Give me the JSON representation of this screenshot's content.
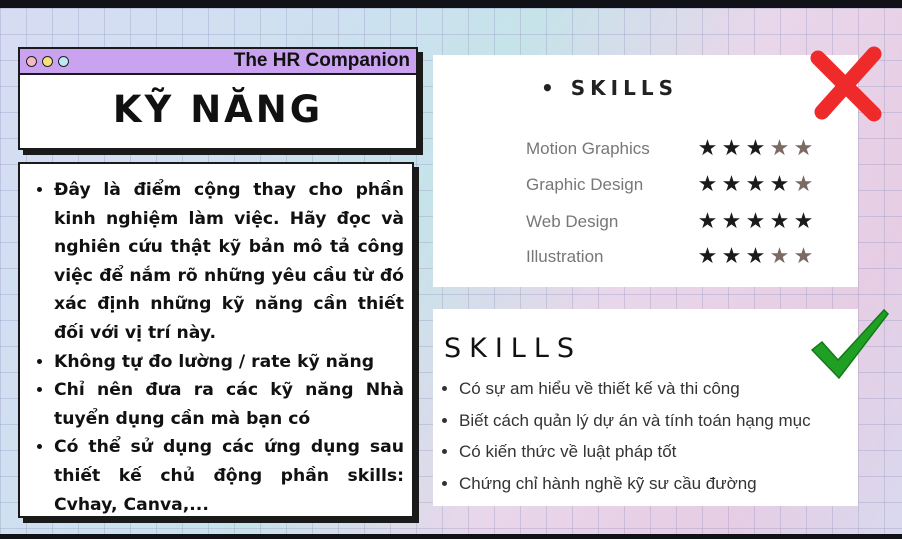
{
  "title_card": {
    "brand": "The HR Companion",
    "title": "KỸ NĂNG"
  },
  "tips": [
    "Đây là điểm cộng thay cho phần kinh nghiệm làm việc. Hãy đọc và nghiên cứu thật kỹ bản mô tả công việc để nắm rõ những yêu cầu từ đó xác định những kỹ năng cần thiết đối với vị trí này.",
    "Không tự đo lường / rate kỹ năng",
    "Chỉ nên đưa ra các kỹ năng Nhà tuyển dụng cần mà bạn có",
    "Có thể sử dụng các ứng dụng sau thiết kế chủ động phần skills: Cvhay, Canva,..."
  ],
  "bad_example": {
    "heading": "• SKILLS",
    "skills": [
      {
        "name": "Motion Graphics",
        "rating": 3,
        "max": 5
      },
      {
        "name": "Graphic Design",
        "rating": 4,
        "max": 5
      },
      {
        "name": "Web Design",
        "rating": 5,
        "max": 5
      },
      {
        "name": "Illustration",
        "rating": 3,
        "max": 5
      }
    ],
    "mark_icon": "red-x-icon"
  },
  "good_example": {
    "heading": "SKILLS",
    "items": [
      "Có sự am hiểu về thiết kế và thi công",
      "Biết cách quản lý dự án và tính toán hạng mục",
      "Có kiến thức về luật pháp tốt",
      "Chứng chỉ hành nghề kỹ sư cầu đường"
    ],
    "mark_icon": "green-check-icon"
  },
  "colors": {
    "title_header": "#c9a3f0",
    "x_mark": "#ee2a2a",
    "check_mark": "#1fa024",
    "star_on": "#1a1a1a",
    "star_off": "#7a6a62"
  }
}
